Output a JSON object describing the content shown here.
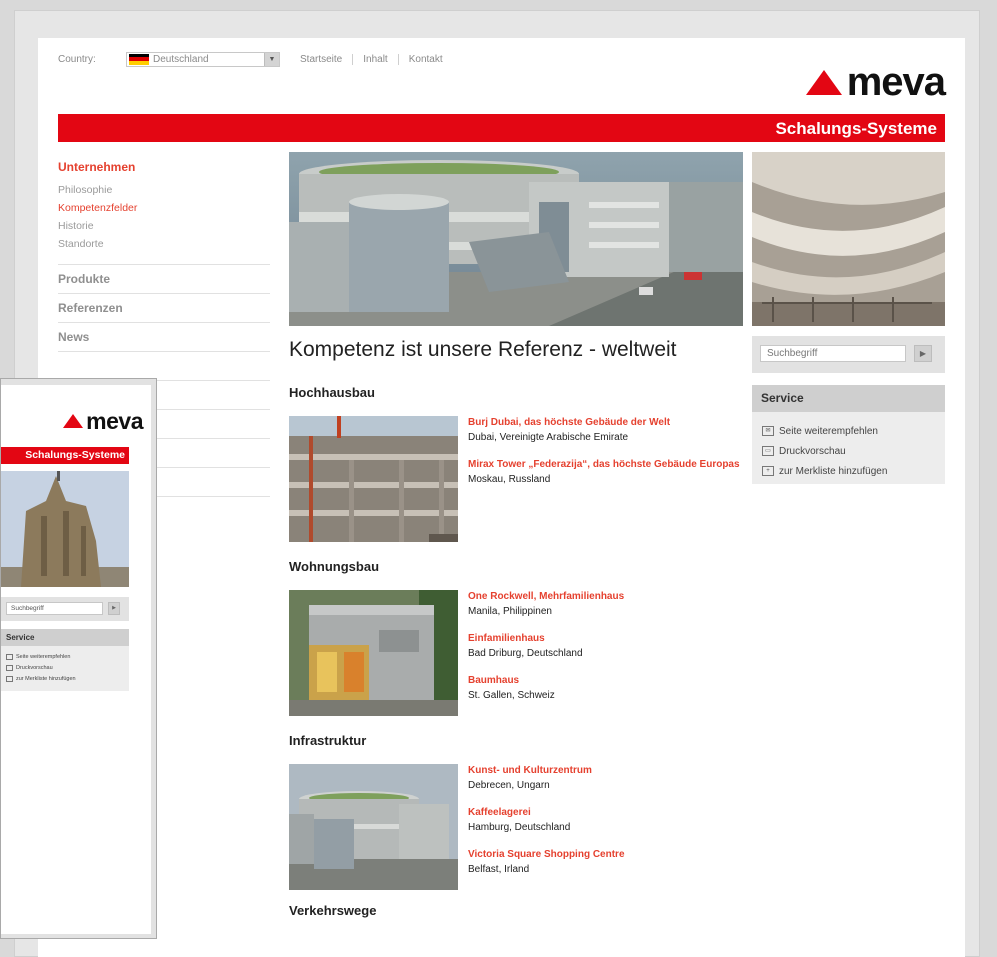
{
  "topbar": {
    "country_label": "Country:",
    "country_value": "Deutschland",
    "nav": [
      "Startseite",
      "Inhalt",
      "Kontakt"
    ]
  },
  "brand": {
    "logo_text": "meva",
    "tagline": "Schalungs-Systeme",
    "accent_color": "#e30613",
    "link_color": "#e5412f"
  },
  "leftnav": {
    "section_title": "Unternehmen",
    "sub_items": [
      {
        "label": "Philosophie",
        "active": false
      },
      {
        "label": "Kompetenzfelder",
        "active": true
      },
      {
        "label": "Historie",
        "active": false
      },
      {
        "label": "Standorte",
        "active": false
      }
    ],
    "main_items": [
      "Produkte",
      "Referenzen",
      "News"
    ]
  },
  "search": {
    "placeholder": "Suchbegriff"
  },
  "service": {
    "title": "Service",
    "items": [
      {
        "label": "Seite weiterempfehlen",
        "icon": "mail-icon"
      },
      {
        "label": "Druckvorschau",
        "icon": "printer-icon"
      },
      {
        "label": "zur Merkliste hinzufügen",
        "icon": "bookmark-icon"
      }
    ]
  },
  "content": {
    "title": "Kompetenz ist unsere Referenz - weltweit",
    "sections": [
      {
        "title": "Hochhausbau",
        "refs": [
          {
            "title": "Burj Dubai, das höchste Gebäude der Welt",
            "location": "Dubai, Vereinigte Arabische Emirate"
          },
          {
            "title": "Mirax Tower „Federazija“, das höchste Gebäude Europas",
            "location": "Moskau, Russland"
          }
        ]
      },
      {
        "title": "Wohnungsbau",
        "refs": [
          {
            "title": "One Rockwell, Mehrfamilienhaus",
            "location": "Manila, Philippinen"
          },
          {
            "title": "Einfamilienhaus",
            "location": "Bad Driburg, Deutschland"
          },
          {
            "title": "Baumhaus",
            "location": "St. Gallen, Schweiz"
          }
        ]
      },
      {
        "title": "Infrastruktur",
        "refs": [
          {
            "title": "Kunst- und Kulturzentrum",
            "location": "Debrecen, Ungarn"
          },
          {
            "title": "Kaffeelagerei",
            "location": "Hamburg, Deutschland"
          },
          {
            "title": "Victoria Square Shopping Centre",
            "location": "Belfast, Irland"
          }
        ]
      },
      {
        "title": "Verkehrswege",
        "refs": []
      }
    ]
  },
  "mobile": {
    "logo_text": "meva",
    "tagline": "Schalungs-Systeme",
    "search_value": "Suchbegriff",
    "service_title": "Service",
    "service_items": [
      "Seite weiterempfehlen",
      "Druckvorschau",
      "zur Merkliste hinzufügen"
    ]
  }
}
